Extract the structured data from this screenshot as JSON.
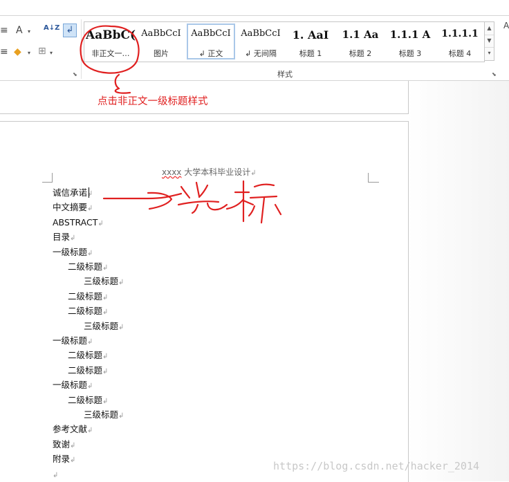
{
  "ribbon": {
    "tools": {
      "align_icon": "≡",
      "text_effect_icon": "A",
      "sort_icon": "A↓Z",
      "para_mark_icon": "↲",
      "shading_icon": "◆",
      "border_icon": "⊞",
      "launcher_icon": "⬊"
    },
    "styles": [
      {
        "preview": "AaBbC(",
        "name": "非正文一…"
      },
      {
        "preview": "AaBbCcI",
        "name": "图片"
      },
      {
        "preview": "AaBbCcI",
        "name": "↲ 正文"
      },
      {
        "preview": "AaBbCcI",
        "name": "↲ 无间隔"
      },
      {
        "preview": "1.  AaI",
        "name": "标题 1"
      },
      {
        "preview": "1.1  Aa",
        "name": "标题 2"
      },
      {
        "preview": "1.1.1  A",
        "name": "标题 3"
      },
      {
        "preview": "1.1.1.1",
        "name": "标题 4"
      }
    ],
    "gallery_scroll": {
      "up": "▲",
      "down": "▼",
      "more": "▾"
    },
    "group_label": "样式",
    "far_right_glyph": "A"
  },
  "annotation": {
    "caption": "点击非正文一级标题样式",
    "cursor_label": "光标",
    "color": "#e02020"
  },
  "document": {
    "header_squiggle": "xxxx",
    "header_rest": " 大学本科毕业设计",
    "para_mark": "↲",
    "lines": [
      {
        "text": "诚信承诺",
        "level": 1
      },
      {
        "text": "中文摘要",
        "level": 1
      },
      {
        "text": "ABSTRACT",
        "level": 1
      },
      {
        "text": "目录",
        "level": 1
      },
      {
        "text": "一级标题",
        "level": 1
      },
      {
        "text": "二级标题",
        "level": 2
      },
      {
        "text": "三级标题",
        "level": 3
      },
      {
        "text": "二级标题",
        "level": 2
      },
      {
        "text": "二级标题",
        "level": 2
      },
      {
        "text": "三级标题",
        "level": 3
      },
      {
        "text": "一级标题",
        "level": 1
      },
      {
        "text": "二级标题",
        "level": 2
      },
      {
        "text": "二级标题",
        "level": 2
      },
      {
        "text": "一级标题",
        "level": 1
      },
      {
        "text": "二级标题",
        "level": 2
      },
      {
        "text": "三级标题",
        "level": 3
      },
      {
        "text": "参考文献",
        "level": 1
      },
      {
        "text": "致谢",
        "level": 1
      },
      {
        "text": "附录",
        "level": 1
      },
      {
        "text": "",
        "level": 1
      }
    ]
  },
  "watermark": "https://blog.csdn.net/hacker_2014"
}
